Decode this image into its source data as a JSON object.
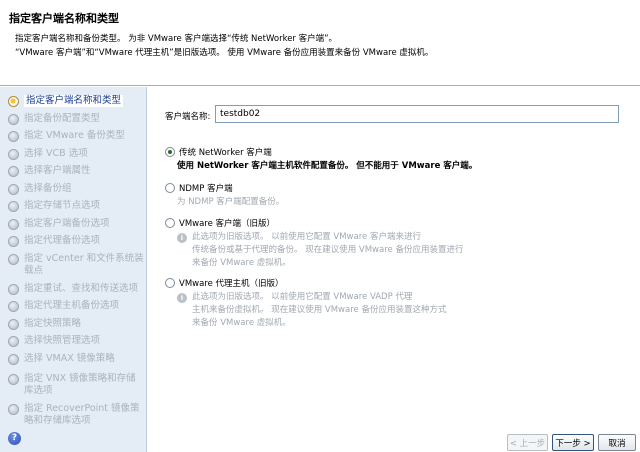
{
  "header": {
    "title": "指定客户端名称和类型",
    "desc_line1": "指定客户端名称和备份类型。 为非 VMware 客户端选择“传统 NetWorker 客户端”。",
    "desc_line2": "“VMware 客户端”和“VMware 代理主机”是旧版选项。 使用 VMware 备份应用装置来备份 VMware 虚拟机。"
  },
  "sidebar": {
    "steps": [
      {
        "label": "指定客户端名称和类型",
        "state": "active"
      },
      {
        "label": "指定备份配置类型"
      },
      {
        "label": "指定 VMware 备份类型"
      },
      {
        "label": "选择 VCB 选项"
      },
      {
        "label": "选择客户端属性"
      },
      {
        "label": "选择备份组"
      },
      {
        "label": "指定存储节点选项"
      },
      {
        "label": "指定客户端备份选项"
      },
      {
        "label": "指定代理备份选项"
      },
      {
        "label": "指定 vCenter 和文件系统装载点"
      },
      {
        "label": "指定重试、查找和传送选项"
      },
      {
        "label": "指定代理主机备份选项"
      },
      {
        "label": "指定快照策略"
      },
      {
        "label": "选择快照管理选项"
      },
      {
        "label": "选择 VMAX 镜像策略"
      },
      {
        "label": "指定 VNX 镜像策略和存储库选项"
      },
      {
        "label": "指定 RecoverPoint 镜像策略和存储库选项"
      }
    ],
    "help_icon": "?"
  },
  "form": {
    "name_label": "客户端名称:",
    "name_value": "testdb02",
    "options": [
      {
        "label": "传统 NetWorker 客户端",
        "checked": true,
        "desc": "使用 NetWorker 客户端主机软件配置备份。 但不能用于 VMware 客户端。"
      },
      {
        "label": "NDMP 客户端",
        "checked": false,
        "desc": "为 NDMP 客户端配置备份。"
      },
      {
        "label": "VMware 客户端（旧版）",
        "checked": false,
        "info": [
          "此选项为旧版选项。 以前使用它配置 VMware 客户端来进行",
          "传统备份或基于代理的备份。 现在建议使用 VMware 备份应用装置进行",
          "来备份 VMware 虚拟机。"
        ]
      },
      {
        "label": "VMware 代理主机（旧版）",
        "checked": false,
        "info": [
          "此选项为旧版选项。 以前使用它配置 VMware VADP 代理",
          "主机来备份虚拟机。 现在建议使用 VMware 备份应用装置这种方式",
          "来备份 VMware 虚拟机。"
        ]
      }
    ]
  },
  "footer": {
    "prev": "< 上一步",
    "next": "下一步 >",
    "cancel": "取消"
  }
}
